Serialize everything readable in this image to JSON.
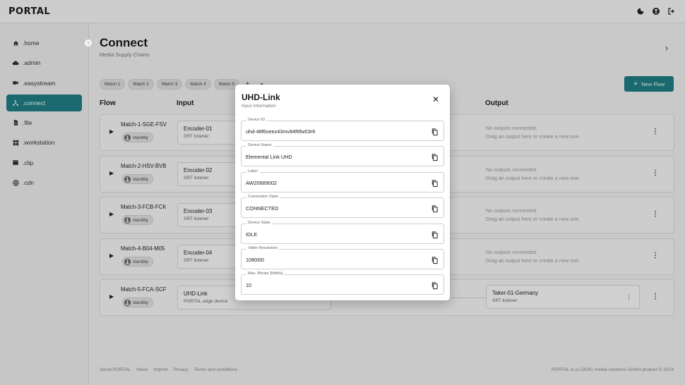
{
  "app": {
    "logo": "PORTAL"
  },
  "sidebar": {
    "items": [
      {
        "label": ".home",
        "icon": "home-icon"
      },
      {
        "label": ".admin",
        "icon": "cloud-icon"
      },
      {
        "label": ".easystream",
        "icon": "video-icon"
      },
      {
        "label": ".connect",
        "icon": "connect-icon",
        "active": true
      },
      {
        "label": ".file",
        "icon": "file-icon"
      },
      {
        "label": ".workstation",
        "icon": "grid-icon"
      },
      {
        "label": ".clip",
        "icon": "clapper-icon"
      },
      {
        "label": ".cdn",
        "icon": "globe-icon"
      }
    ]
  },
  "page": {
    "title": "Connect",
    "subtitle": "Media Supply Chains"
  },
  "chips": [
    "Match 1",
    "Match 2",
    "Match 3",
    "Match 4",
    "Match 5"
  ],
  "new_flow_label": "New Flow",
  "columns": {
    "flow": "Flow",
    "input": "Input",
    "output": "Output"
  },
  "flows": [
    {
      "name": "Match-1-SGE-FSV",
      "status": "standby",
      "input_name": "Encoder-01",
      "input_type": "SRT listener",
      "no_output_1": "No outputs connected.",
      "no_output_2": "Drag an output here or create a new one."
    },
    {
      "name": "Match-2-HSV-BVB",
      "status": "standby",
      "input_name": "Encoder-02",
      "input_type": "SRT listener",
      "no_output_1": "No outputs connected.",
      "no_output_2": "Drag an output here or create a new one."
    },
    {
      "name": "Match-3-FCB-FCK",
      "status": "standby",
      "input_name": "Encoder-03",
      "input_type": "SRT listener",
      "no_output_1": "No outputs connected.",
      "no_output_2": "Drag an output here or create a new one."
    },
    {
      "name": "Match-4-B04-M05",
      "status": "standby",
      "input_name": "Encoder-04",
      "input_type": "SRT listener",
      "no_output_1": "No outputs connected.",
      "no_output_2": "Drag an output here or create a new one."
    },
    {
      "name": "Match-5-FCA-SCF",
      "status": "standby",
      "input_name": "UHD-Link",
      "input_type": "PORTAL.edge device",
      "output_name": "Taker-01-Germany",
      "output_type": "SRT listener"
    }
  ],
  "footer": {
    "links": [
      "About PORTAL",
      "News",
      "Imprint",
      "Privacy",
      "Terms and conditions"
    ],
    "copyright": "PORTAL is a LOGIC media solutions GmbH product © 2024"
  },
  "modal": {
    "title": "UHD-Link",
    "subtitle": "Input Information",
    "fields": [
      {
        "label": "Device ID",
        "value": "uhd-48f6seez43mv84fttfw03r8"
      },
      {
        "label": "Device Name",
        "value": "Elemental Link UHD"
      },
      {
        "label": "Label",
        "value": "AW20689002"
      },
      {
        "label": "Connection State",
        "value": "CONNECTED"
      },
      {
        "label": "Device State",
        "value": "IDLE"
      },
      {
        "label": "Video Resolution",
        "value": "1080i50"
      },
      {
        "label": "Max. Bitrate [Mbit/s]",
        "value": "10"
      }
    ]
  },
  "colors": {
    "accent": "#1f7f86"
  }
}
